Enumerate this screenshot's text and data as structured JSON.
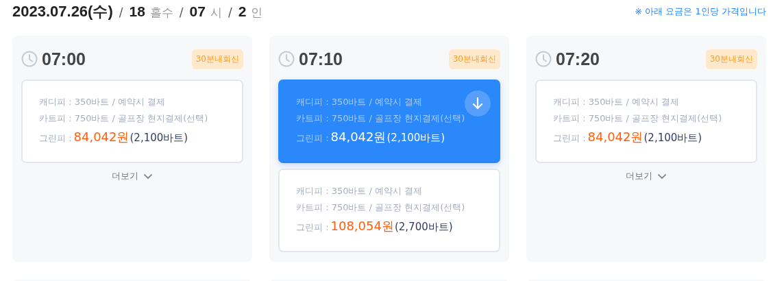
{
  "header": {
    "date": "2023.07.26(수)",
    "items": [
      {
        "value": "18",
        "unit": "홀수"
      },
      {
        "value": "07",
        "unit": "시"
      },
      {
        "value": "2",
        "unit": "인"
      }
    ],
    "separator": "/"
  },
  "notice": "※ 아래 요금은 1인당 가격입니다",
  "slots": [
    {
      "time": "07:00",
      "badge": "30분내회신",
      "options": [
        {
          "selected": false,
          "caddie": "캐디피 : 350바트 / 예약시 결제",
          "cart": "카트피 : 750바트 / 골프장 현지결제(선택)",
          "green_label": "그린피 :",
          "price": "84,042원",
          "baht": "(2,100바트)"
        }
      ],
      "more": "더보기"
    },
    {
      "time": "07:10",
      "badge": "30분내회신",
      "options": [
        {
          "selected": true,
          "caddie": "캐디피 : 350바트 / 예약시 결제",
          "cart": "카트피 : 750바트 / 골프장 현지결제(선택)",
          "green_label": "그린피 :",
          "price": "84,042원",
          "baht": "(2,100바트)"
        },
        {
          "selected": false,
          "caddie": "캐디피 : 350바트 / 예약시 결제",
          "cart": "카트피 : 750바트 / 골프장 현지결제(선택)",
          "green_label": "그린피 :",
          "price": "108,054원",
          "baht": "(2,700바트)"
        }
      ]
    },
    {
      "time": "07:20",
      "badge": "30분내회신",
      "options": [
        {
          "selected": false,
          "caddie": "캐디피 : 350바트 / 예약시 결제",
          "cart": "카트피 : 750바트 / 골프장 현지결제(선택)",
          "green_label": "그린피 :",
          "price": "84,042원",
          "baht": "(2,100바트)"
        }
      ],
      "more": "더보기"
    }
  ]
}
